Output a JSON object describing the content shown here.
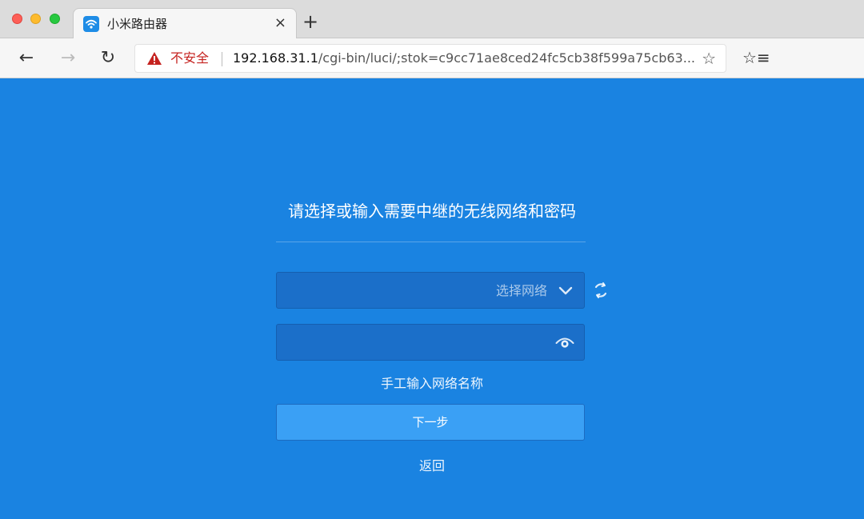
{
  "browser": {
    "tab": {
      "title": "小米路由器",
      "favicon": "wifi-icon",
      "close_glyph": "×"
    },
    "new_tab_glyph": "+",
    "toolbar": {
      "back_glyph": "←",
      "forward_glyph": "→",
      "reload_glyph": "↻",
      "security_label": "不安全",
      "url_host": "192.168.31.1",
      "url_path": "/cgi-bin/luci/;stok=c9cc71ae8ced24fc5cb38f599a75cb63...",
      "star_glyph": "☆",
      "favorites_glyph": "☆≡"
    },
    "colors": {
      "security_warning": "#c5221f",
      "page_background": "#1a83e1"
    }
  },
  "page": {
    "heading": "请选择或输入需要中继的无线网络和密码",
    "network_select": {
      "placeholder": "选择网络",
      "icon": "chevron-down-icon"
    },
    "refresh_icon": "refresh-icon",
    "password_field": {
      "value": "",
      "icon": "eye-icon"
    },
    "manual_link": "手工输入网络名称",
    "next_button": "下一步",
    "back_link": "返回",
    "colors": {
      "field_background": "#1b6fc9",
      "button_background": "#3aa0f5"
    }
  }
}
